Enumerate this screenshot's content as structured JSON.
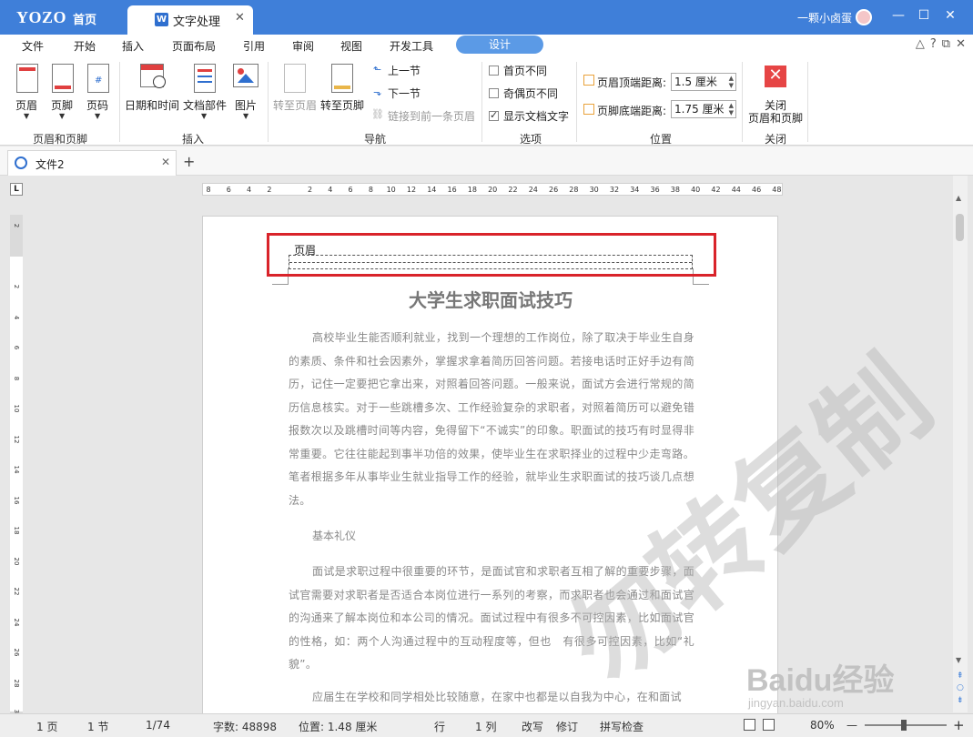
{
  "app": {
    "brand": "YOZO",
    "home_tab": "首页",
    "doc_tab": "文字处理",
    "doc_tab_icon": "W",
    "user": "一颗小卤蛋",
    "window_controls": [
      "—",
      "☐",
      "✕"
    ]
  },
  "menu": {
    "items": [
      "文件",
      "开始",
      "插入",
      "页面布局",
      "引用",
      "审阅",
      "视图",
      "开发工具"
    ],
    "active": "设计"
  },
  "ribbon": {
    "header_footer": {
      "header": "页眉",
      "footer": "页脚",
      "page_number": "页码",
      "group_label": "页眉和页脚"
    },
    "insert": {
      "datetime": "日期和时间",
      "doc_parts": "文档部件",
      "picture": "图片",
      "group_label": "插入"
    },
    "navigation": {
      "goto_header": "转至页眉",
      "goto_footer": "转至页脚",
      "prev_section": "上一节",
      "next_section": "下一节",
      "link_prev": "链接到前一条页眉",
      "group_label": "导航"
    },
    "options": {
      "diff_first": "首页不同",
      "diff_odd_even": "奇偶页不同",
      "show_doc_text": "显示文档文字",
      "group_label": "选项"
    },
    "position": {
      "header_top_label": "页眉顶端距离:",
      "header_top_value": "1.5 厘米",
      "footer_bottom_label": "页脚底端距离:",
      "footer_bottom_value": "1.75 厘米",
      "group_label": "位置"
    },
    "close": {
      "label_line1": "关闭",
      "label_line2": "页眉和页脚",
      "group_label": "关闭"
    }
  },
  "file_tab": {
    "name": "文件2",
    "add": "+"
  },
  "ruler": {
    "corner": "L",
    "ticks": [
      "8",
      "6",
      "4",
      "2",
      "",
      "2",
      "4",
      "6",
      "8",
      "10",
      "12",
      "14",
      "16",
      "18",
      "20",
      "22",
      "24",
      "26",
      "28",
      "30",
      "32",
      "34",
      "36",
      "38",
      "40",
      "42",
      "44",
      "46",
      "48"
    ],
    "vticks": [
      "2",
      "",
      "2",
      "4",
      "6",
      "8",
      "10",
      "12",
      "14",
      "16",
      "18",
      "20",
      "22",
      "24",
      "26",
      "28",
      "30"
    ]
  },
  "document": {
    "header_label": "页眉",
    "title": "大学生求职面试技巧",
    "para1": "高校毕业生能否顺利就业，找到一个理想的工作岗位，除了取决于毕业生自身的素质、条件和社会因素外，掌握求拿着简历回答问题。若接电话时正好手边有简历，记住一定要把它拿出来，对照着回答问题。一般来说，面试方会进行常规的简历信息核实。对于一些跳槽多次、工作经验复杂的求职者，对照着简历可以避免错报数次以及跳槽时间等内容，免得留下“不诚实”的印象。职面试的技巧有时显得非常重要。它往往能起到事半功倍的效果，使毕业生在求职择业的过程中少走弯路。笔者根据多年从事毕业生就业指导工作的经验，就毕业生求职面试的技巧谈几点想法。",
    "subhead": "基本礼仪",
    "para2": "面试是求职过程中很重要的环节，是面试官和求职者互相了解的重要步骤，面试官需要对求职者是否适合本岗位进行一系列的考察，而求职者也会通过和面试官的沟通来了解本岗位和本公司的情况。面试过程中有很多不可控因素，比如面试官的性格，如：两个人沟通过程中的互动程度等，但也　有很多可控因素，比如“礼貌”。",
    "para3": "应届生在学校和同学相处比较随意，在家中也都是以自我为中心，在和面试"
  },
  "watermark": {
    "text": "勿转复制",
    "baidu": "Baidu经验",
    "baidu_url": "jingyan.baidu.com"
  },
  "status": {
    "page": "1 页",
    "section": "1 节",
    "pages": "1/74",
    "words": "字数: 48898",
    "position": "位置: 1.48 厘米",
    "row": "行",
    "col": "1 列",
    "revise": "改写",
    "track": "修订",
    "spell": "拼写检查",
    "zoom": "80%",
    "zoom_minus": "—",
    "zoom_plus": "+"
  },
  "colors": {
    "titlebar": "#3f7fd9",
    "accent": "#5b9ae6",
    "highlight": "#d9232a"
  }
}
